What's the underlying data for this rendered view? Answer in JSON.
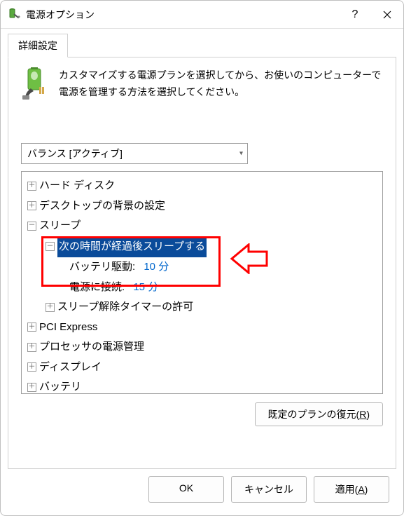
{
  "titlebar": {
    "title": "電源オプション"
  },
  "tab": {
    "label": "詳細設定"
  },
  "intro": {
    "text": "カスタマイズする電源プランを選択してから、お使いのコンピューターで電源を管理する方法を選択してください。"
  },
  "plan_select": {
    "value": "バランス [アクティブ]"
  },
  "tree": {
    "hard_disk": "ハード ディスク",
    "desktop_bg": "デスクトップの背景の設定",
    "sleep": "スリープ",
    "sleep_after": "次の時間が経過後スリープする",
    "battery_label": "バッテリ駆動:",
    "battery_value": "10 分",
    "ac_label": "電源に接続:",
    "ac_value": "15 分",
    "wake_timers": "スリープ解除タイマーの許可",
    "pci": "PCI Express",
    "processor": "プロセッサの電源管理",
    "display": "ディスプレイ",
    "battery": "バッテリ"
  },
  "restore": {
    "label": "既定のプランの復元(",
    "access": "R",
    "tail": ")"
  },
  "buttons": {
    "ok": "OK",
    "cancel": "キャンセル",
    "apply_label": "適用(",
    "apply_access": "A",
    "apply_tail": ")"
  }
}
